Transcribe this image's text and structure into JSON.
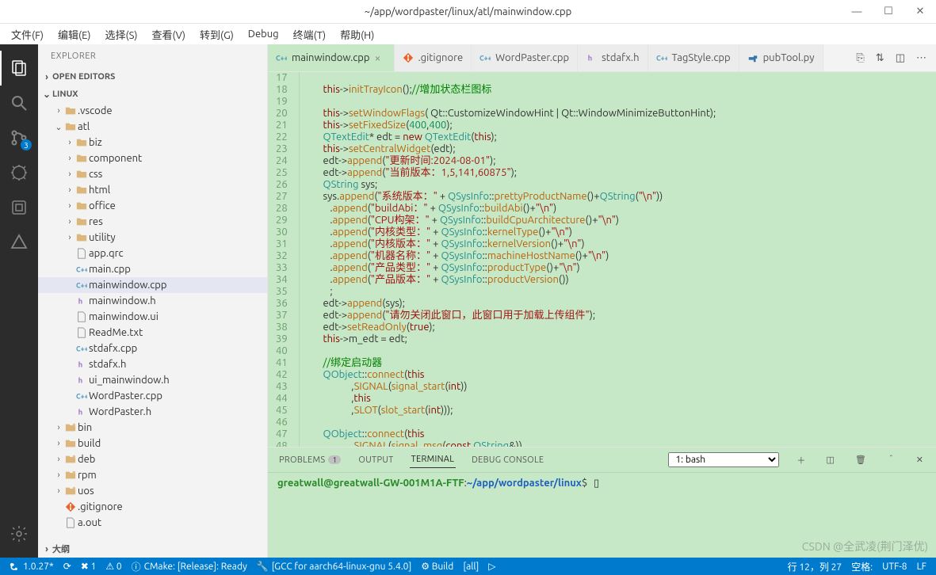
{
  "title": "~/app/wordpaster/linux/atl/mainwindow.cpp",
  "window_controls": {
    "min": "—",
    "max": "☐",
    "close": "✕"
  },
  "menu": [
    "文件(F)",
    "编辑(E)",
    "选择(S)",
    "查看(V)",
    "转到(G)",
    "Debug",
    "终端(T)",
    "帮助(H)"
  ],
  "sidebar": {
    "title": "EXPLORER",
    "open_editors": "OPEN EDITORS",
    "root": "LINUX",
    "outline": "大纲",
    "tree": [
      {
        "name": ".vscode",
        "type": "folder",
        "depth": 1,
        "chev": "›",
        "color": "blue"
      },
      {
        "name": "atl",
        "type": "folder",
        "depth": 1,
        "chev": "⌄",
        "color": "yellow",
        "open": true
      },
      {
        "name": "biz",
        "type": "folder",
        "depth": 2,
        "chev": "›"
      },
      {
        "name": "component",
        "type": "folder",
        "depth": 2,
        "chev": "›"
      },
      {
        "name": "css",
        "type": "folder",
        "depth": 2,
        "chev": "›"
      },
      {
        "name": "html",
        "type": "folder",
        "depth": 2,
        "chev": "›"
      },
      {
        "name": "office",
        "type": "folder",
        "depth": 2,
        "chev": "›"
      },
      {
        "name": "res",
        "type": "folder",
        "depth": 2,
        "chev": "›"
      },
      {
        "name": "utility",
        "type": "folder",
        "depth": 2,
        "chev": "›"
      },
      {
        "name": "app.qrc",
        "type": "file",
        "depth": 2,
        "icon": "file"
      },
      {
        "name": "main.cpp",
        "type": "file",
        "depth": 2,
        "icon": "cpp"
      },
      {
        "name": "mainwindow.cpp",
        "type": "file",
        "depth": 2,
        "icon": "cpp",
        "selected": true
      },
      {
        "name": "mainwindow.h",
        "type": "file",
        "depth": 2,
        "icon": "h"
      },
      {
        "name": "mainwindow.ui",
        "type": "file",
        "depth": 2,
        "icon": "file"
      },
      {
        "name": "ReadMe.txt",
        "type": "file",
        "depth": 2,
        "icon": "file"
      },
      {
        "name": "stdafx.cpp",
        "type": "file",
        "depth": 2,
        "icon": "cpp"
      },
      {
        "name": "stdafx.h",
        "type": "file",
        "depth": 2,
        "icon": "h"
      },
      {
        "name": "ui_mainwindow.h",
        "type": "file",
        "depth": 2,
        "icon": "h"
      },
      {
        "name": "WordPaster.cpp",
        "type": "file",
        "depth": 2,
        "icon": "cpp"
      },
      {
        "name": "WordPaster.h",
        "type": "file",
        "depth": 2,
        "icon": "h"
      },
      {
        "name": "bin",
        "type": "folder",
        "depth": 1,
        "chev": "›",
        "dirty": true
      },
      {
        "name": "build",
        "type": "folder",
        "depth": 1,
        "chev": "›"
      },
      {
        "name": "deb",
        "type": "folder",
        "depth": 1,
        "chev": "›",
        "dirty": true
      },
      {
        "name": "rpm",
        "type": "folder",
        "depth": 1,
        "chev": "›",
        "dirty": true
      },
      {
        "name": "uos",
        "type": "folder",
        "depth": 1,
        "chev": "›",
        "dirty": true
      },
      {
        "name": ".gitignore",
        "type": "file",
        "depth": 1,
        "icon": "git"
      },
      {
        "name": "a.out",
        "type": "file",
        "depth": 1,
        "icon": "file"
      }
    ]
  },
  "activity_badge": "3",
  "tabs": [
    {
      "label": "mainwindow.cpp",
      "icon": "cpp",
      "active": true,
      "close": true
    },
    {
      "label": ".gitignore",
      "icon": "git"
    },
    {
      "label": "WordPaster.cpp",
      "icon": "cpp"
    },
    {
      "label": "stdafx.h",
      "icon": "h"
    },
    {
      "label": "TagStyle.cpp",
      "icon": "cpp"
    },
    {
      "label": "pubTool.py",
      "icon": "py"
    }
  ],
  "code_start_line": 17,
  "panel": {
    "tabs": {
      "problems": "PROBLEMS",
      "problems_badge": "1",
      "output": "OUTPUT",
      "terminal": "TERMINAL",
      "debug": "DEBUG CONSOLE"
    },
    "term_select": "1: bash",
    "prompt_user": "greatwall@greatwall-GW-001M1A-FTF",
    "prompt_path": "~/app/wordpaster/linux",
    "prompt_sep": ":",
    "prompt_tail": "$"
  },
  "status": {
    "branch": "1.0.27*",
    "sync": "⟳",
    "errors": "✖ 1",
    "warnings": "⚠ 0",
    "cmake": "CMake: [Release]: Ready",
    "gcc": "[GCC for aarch64-linux-gnu 5.4.0]",
    "build": "⚙ Build",
    "target": "[all]",
    "debug_icon": "▷",
    "line_col": "行 12，列 27",
    "spaces": "空格: ",
    "encoding": "UTF-8",
    "eol": "LF"
  },
  "watermark": "CSDN @全武凌(荆门泽优)"
}
